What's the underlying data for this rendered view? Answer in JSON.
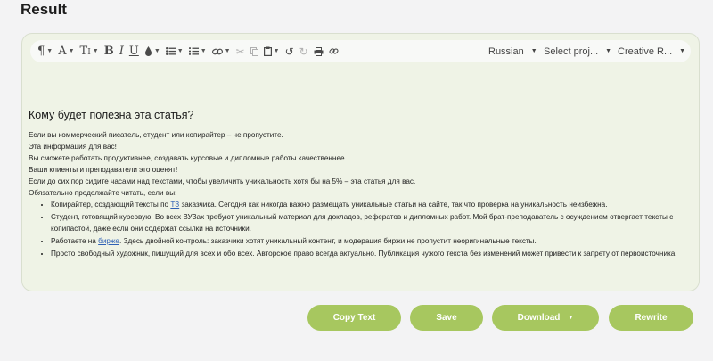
{
  "result_heading": "Result",
  "toolbar": {
    "language": "Russian",
    "project": "Select proj...",
    "mode": "Creative R..."
  },
  "article": {
    "heading": "Кому будет полезна эта статья?",
    "paragraphs": [
      "Если вы коммерческий писатель, студент или копирайтер – не пропустите.",
      "Эта информация для вас!",
      "Вы сможете работать продуктивнее, создавать курсовые и дипломные работы качественнее.",
      "Ваши клиенты и преподаватели это оценят!",
      "Если до сих пор сидите часами над текстами, чтобы увеличить уникальность хотя бы на 5% – эта статья для вас.",
      "Обязательно продолжайте читать, если вы:"
    ],
    "bullets": [
      {
        "before": "Копирайтер, создающий тексты по ",
        "link": "ТЗ",
        "after": " заказчика. Сегодня как никогда важно размещать уникальные статьи на сайте, так что проверка на уникальность неизбежна."
      },
      {
        "text": "Студент, готовящий курсовую. Во всех ВУЗах требуют уникальный материал для докладов, рефератов и дипломных работ. Мой брат-преподаватель с осуждением отвергает тексты с копипастой, даже если они содержат ссылки на источники."
      },
      {
        "before": "Работаете на ",
        "link": "бирже",
        "after": ". Здесь двойной контроль: заказчики хотят уникальный контент, и модерация биржи не пропустит неоригинальные тексты."
      },
      {
        "text": "Просто свободный художник, пишущий для всех и обо всех. Авторское право всегда актуально. Публикация чужого текста без изменений может привести к запрету от первоисточника."
      }
    ]
  },
  "buttons": {
    "copy": "Copy Text",
    "save": "Save",
    "download": "Download",
    "rewrite": "Rewrite"
  },
  "colors": {
    "accent": "#a7c75f",
    "panel_bg": "#eff3e6",
    "link": "#2f61b5"
  }
}
